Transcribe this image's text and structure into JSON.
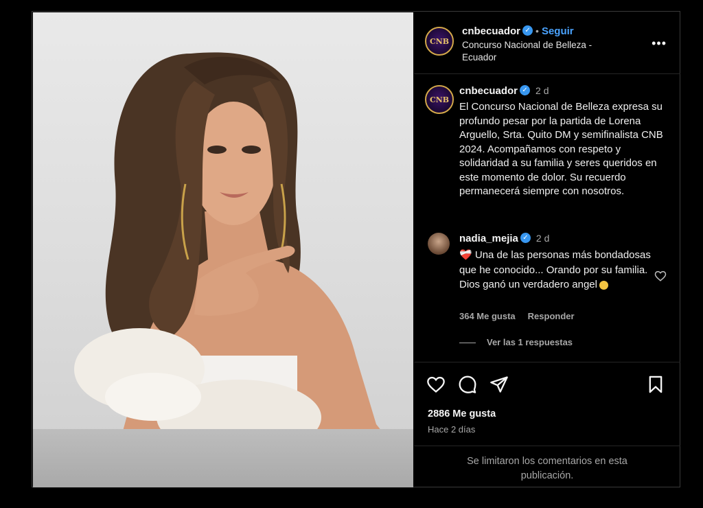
{
  "post": {
    "account": {
      "username": "cnbecuador",
      "avatar_text": "CNB",
      "verified_icon": "verified-badge-icon",
      "follow_label": "Seguir",
      "display_name": "Concurso Nacional de Belleza - Ecuador"
    },
    "caption": {
      "username": "cnbecuador",
      "time": "2 d",
      "text": "El Concurso Nacional de Belleza expresa su profundo pesar por la partida de Lorena Arguello, Srta. Quito DM y semifinalista CNB 2024. Acompañamos con respeto y solidaridad a su familia y seres queridos en este momento de dolor. Su recuerdo permanecerá siempre con nosotros."
    },
    "comment": {
      "username": "nadia_mejia",
      "time": "2 d",
      "heart": "❤️‍🩹",
      "text": "Una de las personas más bondadosas que he conocido... Orando por su familia. Dios ganó un verdadero angel",
      "likes": "364 Me gusta",
      "reply_label": "Responder",
      "view_replies": "Ver las 1 respuestas"
    },
    "likes_count": "2886 Me gusta",
    "posted_ago": "Hace 2 días",
    "comments_limited": "Se limitaron los comentarios en esta publicación."
  },
  "icons": [
    "verified-badge-icon",
    "more-options-icon",
    "heart-icon",
    "comment-icon",
    "share-icon",
    "bookmark-icon",
    "comment-like-heart-icon"
  ],
  "colors": {
    "background": "#000000",
    "link": "#4aa3ff",
    "verified": "#3897f0",
    "muted": "#a8a8a8"
  }
}
